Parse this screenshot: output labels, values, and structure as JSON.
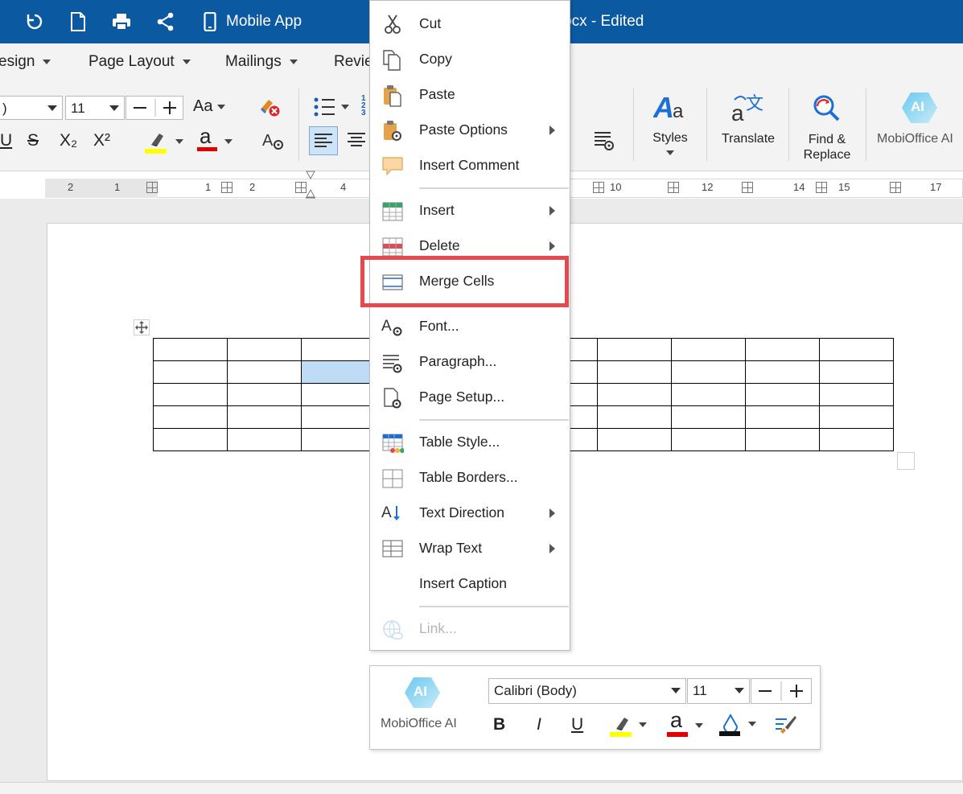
{
  "titlebar": {
    "app_label": "Mobile App",
    "title_fragment": "ocx - Edited"
  },
  "tabs": [
    {
      "label": "esign"
    },
    {
      "label": "Page Layout"
    },
    {
      "label": "Mailings"
    },
    {
      "label": "Revie"
    }
  ],
  "ribbon": {
    "font_name_value": ")",
    "font_size_value": "11",
    "change_case_label": "Aa",
    "superscript_label": "X²",
    "subscript_label": "X₂",
    "underline_label": "U",
    "strike_label": "S",
    "styles_label": "Styles",
    "translate_label": "Translate",
    "find_label_line1": "Find &",
    "find_label_line2": "Replace",
    "ai_label": "MobiOffice AI",
    "ai_badge": "AI"
  },
  "ruler": {
    "numbers": [
      "2",
      "1",
      "1",
      "2",
      "4",
      "10",
      "12",
      "14",
      "15",
      "17"
    ]
  },
  "context_menu": {
    "items": [
      {
        "label": "Cut",
        "icon": "scissors-icon",
        "submenu": false
      },
      {
        "label": "Copy",
        "icon": "copy-icon",
        "submenu": false
      },
      {
        "label": "Paste",
        "icon": "paste-icon",
        "submenu": false
      },
      {
        "label": "Paste Options",
        "icon": "paste-options-icon",
        "submenu": true
      },
      {
        "label": "Insert Comment",
        "icon": "comment-icon",
        "submenu": false
      },
      {
        "label": "Insert",
        "icon": "table-insert-icon",
        "submenu": true
      },
      {
        "label": "Delete",
        "icon": "table-delete-icon",
        "submenu": true
      },
      {
        "label": "Merge Cells",
        "icon": "merge-cells-icon",
        "submenu": false
      },
      {
        "label": "Font...",
        "icon": "font-settings-icon",
        "submenu": false
      },
      {
        "label": "Paragraph...",
        "icon": "paragraph-settings-icon",
        "submenu": false
      },
      {
        "label": "Page Setup...",
        "icon": "page-setup-icon",
        "submenu": false
      },
      {
        "label": "Table Style...",
        "icon": "table-style-icon",
        "submenu": false
      },
      {
        "label": "Table Borders...",
        "icon": "table-borders-icon",
        "submenu": false
      },
      {
        "label": "Text Direction",
        "icon": "text-direction-icon",
        "submenu": true
      },
      {
        "label": "Wrap Text",
        "icon": "wrap-text-icon",
        "submenu": true
      },
      {
        "label": "Insert Caption",
        "icon": "",
        "submenu": false
      },
      {
        "label": "Link...",
        "icon": "link-icon",
        "submenu": false,
        "disabled": true
      }
    ]
  },
  "mini_toolbar": {
    "ai_badge": "AI",
    "ai_label": "MobiOffice AI",
    "font_name": "Calibri (Body)",
    "font_size": "11",
    "bold": "B",
    "italic": "I",
    "underline": "U",
    "font_color_glyph": "a"
  },
  "colors": {
    "titlebar": "#0b5aa1",
    "highlight_frame": "#e5484d",
    "selected_cell": "#bfdcf7",
    "highlighter_yellow": "#ffff00",
    "font_color_red": "#e00000"
  }
}
